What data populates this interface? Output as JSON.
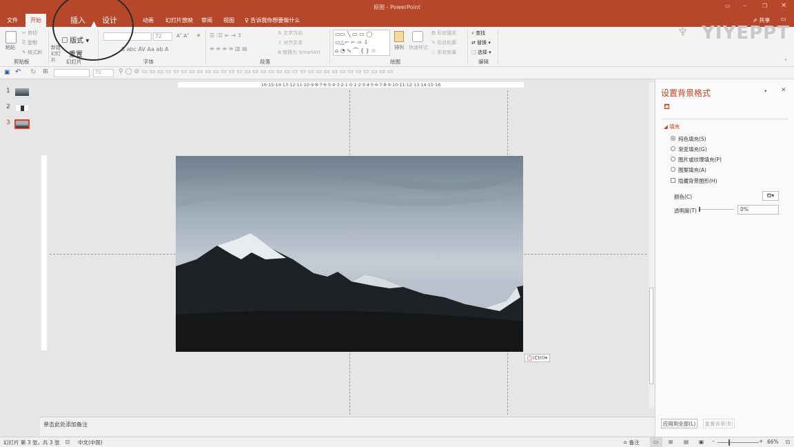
{
  "window": {
    "title": "抠图 - PowerPoint",
    "share": "共享",
    "title_part1": "抠图",
    "title_sep": " - ",
    "title_part2": "PowerPoint"
  },
  "tabs": [
    "文件",
    "开始",
    "插入",
    "设计",
    "动画",
    "幻灯片放映",
    "审阅",
    "视图"
  ],
  "tell_me": "告诉我你想要做什么",
  "ribbon": {
    "groups": [
      "剪贴板",
      "幻灯片",
      "字体",
      "段落",
      "绘图",
      "编辑"
    ],
    "paste": "粘贴",
    "cut": "剪切",
    "copy": "复制",
    "format_painter": "格式刷",
    "new_slide": "新建幻灯片",
    "layout": "版式",
    "reset": "重置",
    "font_size": "72",
    "text_direction": "文字方向",
    "align_text": "对齐文本",
    "smartart": "转换为 SmartArt",
    "arrange": "排列",
    "quick_styles": "快速样式",
    "shape_fill": "形状填充",
    "shape_outline": "形状轮廓",
    "shape_effects": "形状效果",
    "find": "查找",
    "replace": "替换",
    "select": "选择"
  },
  "qat": {
    "font_size": "72"
  },
  "thumbnails": [
    "1",
    "2",
    "3"
  ],
  "ruler_h": "16·15·14·13·12·11·10·9·8·7·6·5·4·3·2·1·0·1·2·3·4·5·6·7·8·9·10·11·12·13·14·15·16",
  "paste_ctrl": "(Ctrl)",
  "notes_placeholder": "单击此处添加备注",
  "panel": {
    "title": "设置背景格式",
    "section": "填充",
    "options": [
      "纯色填充(S)",
      "渐变填充(G)",
      "图片或纹理填充(P)",
      "图案填充(A)"
    ],
    "hide_bg": "隐藏背景图形(H)",
    "color_label": "颜色(C)",
    "transparency_label": "透明度(T)",
    "transparency_value": "0%",
    "apply_all": "应用到全部(L)",
    "reset_bg": "重置背景(B)"
  },
  "status": {
    "slide_info": "幻灯片 第 3 张，共 3 张",
    "language": "中文(中国)",
    "notes": "备注",
    "zoom": "66%"
  },
  "watermark": "YIYEPPT",
  "colors": {
    "accent": "#b7472a",
    "panel_title": "#c43e1c"
  }
}
